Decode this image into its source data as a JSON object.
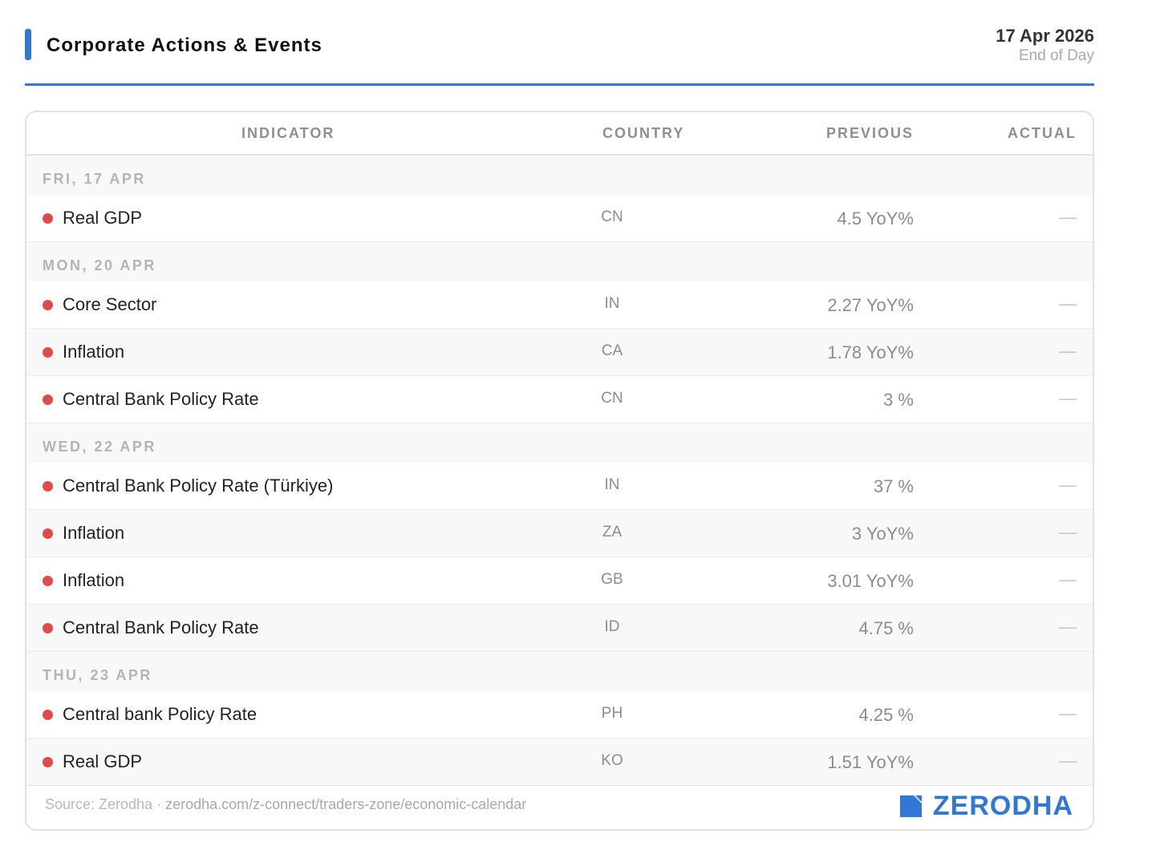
{
  "header": {
    "title": "Corporate Actions & Events",
    "date": "17 Apr 2026",
    "date_sub": "End of Day"
  },
  "table": {
    "columns": {
      "indicator": "INDICATOR",
      "country": "COUNTRY",
      "previous": "PREVIOUS",
      "actual": "ACTUAL"
    },
    "groups": [
      {
        "label": "FRI, 17 APR",
        "rows": [
          {
            "indicator": "Real GDP",
            "country": "CN",
            "previous": "4.5 YoY%",
            "actual": "—"
          }
        ]
      },
      {
        "label": "MON, 20 APR",
        "rows": [
          {
            "indicator": "Core Sector",
            "country": "IN",
            "previous": "2.27 YoY%",
            "actual": "—"
          },
          {
            "indicator": "Inflation",
            "country": "CA",
            "previous": "1.78 YoY%",
            "actual": "—"
          },
          {
            "indicator": "Central Bank Policy Rate",
            "country": "CN",
            "previous": "3 %",
            "actual": "—"
          }
        ]
      },
      {
        "label": "WED, 22 APR",
        "rows": [
          {
            "indicator": "Central Bank Policy Rate (Türkiye)",
            "country": "IN",
            "previous": "37 %",
            "actual": "—"
          },
          {
            "indicator": "Inflation",
            "country": "ZA",
            "previous": "3 YoY%",
            "actual": "—"
          },
          {
            "indicator": "Inflation",
            "country": "GB",
            "previous": "3.01 YoY%",
            "actual": "—"
          },
          {
            "indicator": "Central Bank Policy Rate",
            "country": "ID",
            "previous": "4.75 %",
            "actual": "—"
          }
        ]
      },
      {
        "label": "THU, 23 APR",
        "rows": [
          {
            "indicator": "Central bank Policy Rate",
            "country": "PH",
            "previous": "4.25 %",
            "actual": "—"
          },
          {
            "indicator": "Real GDP",
            "country": "KO",
            "previous": "1.51 YoY%",
            "actual": "—"
          }
        ]
      }
    ]
  },
  "footer": {
    "source_label": "Source: Zerodha",
    "separator": " · ",
    "source_url": "zerodha.com/z-connect/traders-zone/economic-calendar",
    "brand": "ZERODHA"
  },
  "colors": {
    "accent": "#3178d4",
    "dot": "#e04a4a"
  }
}
